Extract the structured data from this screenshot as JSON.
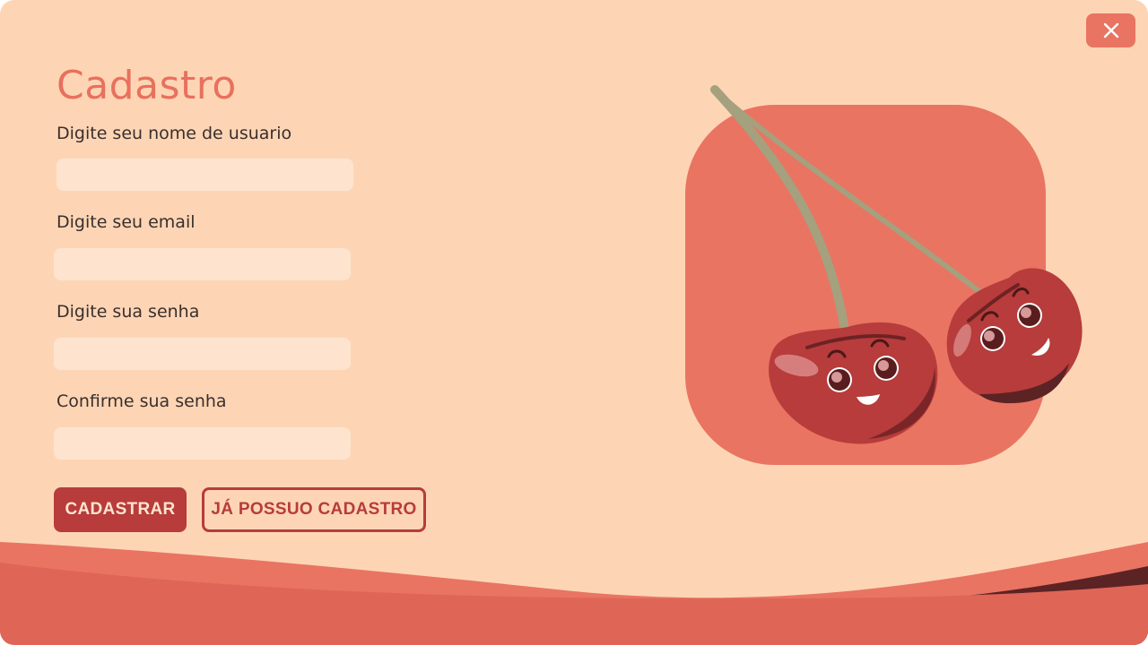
{
  "form": {
    "title": "Cadastro",
    "fields": [
      {
        "label": "Digite seu nome de usuario",
        "value": "",
        "placeholder": ""
      },
      {
        "label": "Digite seu email",
        "value": "",
        "placeholder": ""
      },
      {
        "label": "Digite sua senha",
        "value": "",
        "placeholder": ""
      },
      {
        "label": "Confirme sua senha",
        "value": "",
        "placeholder": ""
      }
    ],
    "submit_label": "CADASTRAR",
    "login_label": "JÁ POSSUO CADASTRO"
  },
  "window": {
    "close_icon": "close-icon"
  },
  "illustration": {
    "icon": "cherries-illustration"
  },
  "colors": {
    "background": "#fdd5b5",
    "accent": "#e9705e",
    "primary": "#b73c3b",
    "field": "#fee4cf",
    "text": "#3a2f2c",
    "dark_wave": "#5c2324"
  }
}
